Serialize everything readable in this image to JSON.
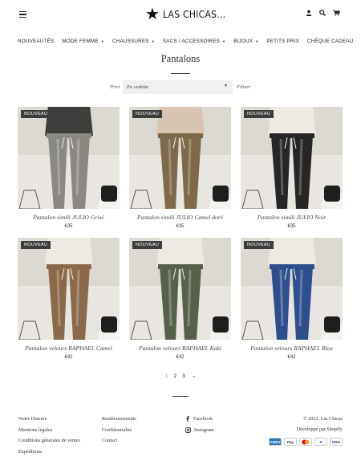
{
  "header": {
    "logo_text": "LAS CHICAS...",
    "icons": [
      "menu-icon",
      "account-icon",
      "search-icon",
      "cart-icon"
    ]
  },
  "nav": {
    "items": [
      {
        "label": "NOUVEAUTÉS",
        "has_dropdown": false
      },
      {
        "label": "MODE FEMME",
        "has_dropdown": true
      },
      {
        "label": "CHAUSSURES",
        "has_dropdown": true
      },
      {
        "label": "SACS / ACCESSOIRES",
        "has_dropdown": true
      },
      {
        "label": "BIJOUX",
        "has_dropdown": true
      },
      {
        "label": "PETITS PRIX",
        "has_dropdown": false
      },
      {
        "label": "CHÈQUE CADEAU",
        "has_dropdown": false
      }
    ]
  },
  "page": {
    "title": "Pantalons",
    "sort_label": "Trier",
    "sort_value": "En vedette",
    "filter_label": "Filtrer"
  },
  "products": [
    {
      "badge": "NOUVEAU",
      "name": "Pantalon simili JULIO Grisé",
      "price": "€35",
      "pant_color": "#8a8883",
      "top_color": "#3b3e3b"
    },
    {
      "badge": "NOUVEAU",
      "name": "Pantalon simili JULIO Camel doré",
      "price": "€35",
      "pant_color": "#7d6a48",
      "top_color": "#d8c4b2"
    },
    {
      "badge": "NOUVEAU",
      "name": "Pantalon simili JULIO Noir",
      "price": "€35",
      "pant_color": "#262627",
      "top_color": "#efeae4"
    },
    {
      "badge": "NOUVEAU",
      "name": "Pantalon velours RAPHAEL Camel",
      "price": "€42",
      "pant_color": "#8a6a48",
      "top_color": "#eeeae3"
    },
    {
      "badge": "NOUVEAU",
      "name": "Pantalon velours RAPHAEL Kaki",
      "price": "€42",
      "pant_color": "#57604b",
      "top_color": "#eeeae3"
    },
    {
      "badge": "NOUVEAU",
      "name": "Pantalon velours RAPHAEL Bleu",
      "price": "€42",
      "pant_color": "#2e4f8e",
      "top_color": "#eeeae3"
    }
  ],
  "pagination": {
    "pages": [
      "1",
      "2",
      "3"
    ],
    "current": "1",
    "next": "→",
    "active_color": "#d2a14b"
  },
  "footer": {
    "col1": [
      "Notre Histoire",
      "Mentions légales",
      "Conditions générales de ventes",
      "Expéditions"
    ],
    "col2": [
      "Remboursements",
      "Confidentialité",
      "Contact"
    ],
    "social": [
      {
        "icon": "facebook-icon",
        "label": "Facebook"
      },
      {
        "icon": "instagram-icon",
        "label": "Instagram"
      }
    ],
    "copyright": "© 2022, Las Chicas",
    "powered": "Développé par Shopify",
    "payments": [
      "AMEX",
      "Pay",
      "MC",
      "P",
      "VISA"
    ]
  }
}
